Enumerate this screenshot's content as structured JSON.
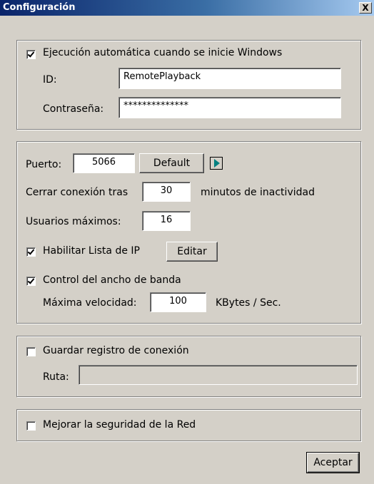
{
  "window": {
    "title": "Configuración",
    "close_symbol": "X"
  },
  "startup": {
    "autostart": {
      "label": "Ejecución automática cuando se inicie Windows",
      "checked": true
    },
    "id_label": "ID:",
    "id_value": "RemotePlayback",
    "password_label": "Contraseña:",
    "password_value": "**************"
  },
  "connection": {
    "port_label": "Puerto:",
    "port_value": "5066",
    "default_button": "Default",
    "arrow_icon": "play-arrow-icon",
    "close_after_label": "Cerrar conexión tras",
    "close_after_value": "30",
    "close_after_suffix": "minutos de inactividad",
    "max_users_label": "Usuarios máximos:",
    "max_users_value": "16",
    "ip_list": {
      "label": "Habilitar Lista de IP",
      "checked": true
    },
    "edit_button": "Editar",
    "bandwidth": {
      "label": "Control del ancho de banda",
      "checked": true
    },
    "max_speed_label": "Máxima velocidad:",
    "max_speed_value": "100",
    "max_speed_unit": "KBytes / Sec."
  },
  "log": {
    "save_log": {
      "label": "Guardar registro de conexión",
      "checked": false
    },
    "path_label": "Ruta:",
    "path_value": ""
  },
  "security": {
    "improve_security": {
      "label": "Mejorar la seguridad de la Red",
      "checked": false
    }
  },
  "footer": {
    "accept_button": "Aceptar"
  },
  "colors": {
    "titlebar_start": "#0a246a",
    "titlebar_end": "#a6caf0",
    "face": "#d4d0c8",
    "arrow": "#008080"
  }
}
